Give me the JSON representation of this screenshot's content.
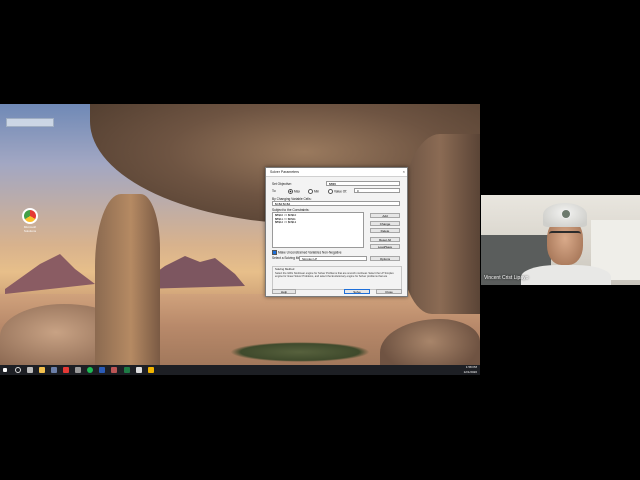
{
  "desktop": {
    "icon_label": "Microsoft Solutions"
  },
  "taskbar": {
    "time": "1:58 PM",
    "date": "12/1/2020"
  },
  "dialog": {
    "title": "Solver Parameters",
    "close": "×",
    "set_objective_label": "Set Objective:",
    "set_objective_value": "$B$5",
    "to_label": "To:",
    "max_label": "Max",
    "min_label": "Min",
    "value_of_label": "Value Of:",
    "value_of_value": "0",
    "changing_label": "By Changing Variable Cells:",
    "changing_value": "$C$2:$C$4",
    "constraints_label": "Subject to the Constraints:",
    "constraints": [
      "$B$10 <= $D$10",
      "$B$11 <= $D$11",
      "$B$12 <= $D$12"
    ],
    "buttons_side": [
      "Add",
      "Change",
      "Delete",
      "Reset All",
      "Load/Save"
    ],
    "unconstrained_label": "Make Unconstrained Variables Non-Negative",
    "select_method_label": "Select a Solving Method:",
    "method_value": "Simplex LP",
    "options_button": "Options",
    "method_heading": "Solving Method",
    "method_desc": "Select the GRG Nonlinear engine for Solver Problems that are smooth nonlinear. Select the LP Simplex engine for linear Solver Problems, and select the Evolutionary engine for Solver problems that are",
    "help_button": "Help",
    "solve_button": "Solve",
    "close_button": "Close"
  },
  "webcam": {
    "participant_name": "Vincent Crist Lipayo"
  }
}
